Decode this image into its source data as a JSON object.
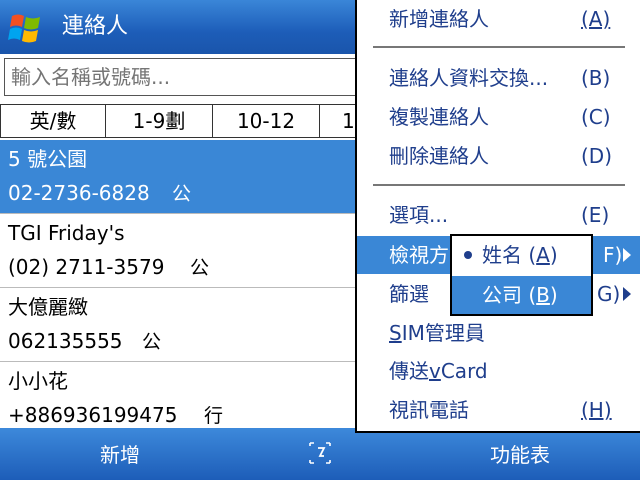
{
  "header": {
    "title": "連絡人",
    "logo_icon": "windows-flag-icon"
  },
  "search": {
    "placeholder": "輸入名稱或號碼..."
  },
  "tabs": [
    "英/數",
    "1-9劃",
    "10-12",
    "1"
  ],
  "contacts": [
    {
      "name": "5 號公園",
      "phone": "02-2736-6828",
      "type": "公",
      "selected": true
    },
    {
      "name": "TGI Friday's",
      "phone": "(02) 2711-3579",
      "type": "公",
      "selected": false
    },
    {
      "name": "大億麗緻",
      "phone": "062135555",
      "type": "公",
      "selected": false
    },
    {
      "name": "小小花",
      "phone": "+886936199475",
      "type": "行",
      "selected": false
    }
  ],
  "menu": {
    "items": [
      {
        "label": "新增連絡人",
        "accel": "(A)"
      },
      {
        "label": "連絡人資料交換...",
        "accel": "(B)"
      },
      {
        "label": "複製連絡人",
        "accel": "(C)"
      },
      {
        "label": "刪除連絡人",
        "accel": "(D)"
      },
      {
        "label": "選項...",
        "accel": "(E)"
      },
      {
        "label": "檢視方",
        "accel": "F)",
        "submenu": true,
        "highlighted": true
      },
      {
        "label": "篩選",
        "accel": "G)",
        "submenu": true
      },
      {
        "label_prefix": "",
        "label_u": "S",
        "label_rest": "IM管理員"
      },
      {
        "label_prefix": "傳送",
        "label_u": "v",
        "label_rest": "Card"
      },
      {
        "label": "視訊電話",
        "accel": "(H)"
      }
    ]
  },
  "submenu": {
    "items": [
      {
        "label_pre": "姓名 (",
        "label_u": "A",
        "label_post": ")",
        "checked": true
      },
      {
        "label_pre": "公司 (",
        "label_u": "B",
        "label_post": ")",
        "highlighted": true
      }
    ]
  },
  "softkeys": {
    "left": "新增",
    "right": "功能表",
    "input_icon": "keyboard-icon"
  },
  "colors": {
    "accent": "#3a87d6",
    "menu_text": "#1f3e8c",
    "titlebar": "#1d5db8"
  }
}
